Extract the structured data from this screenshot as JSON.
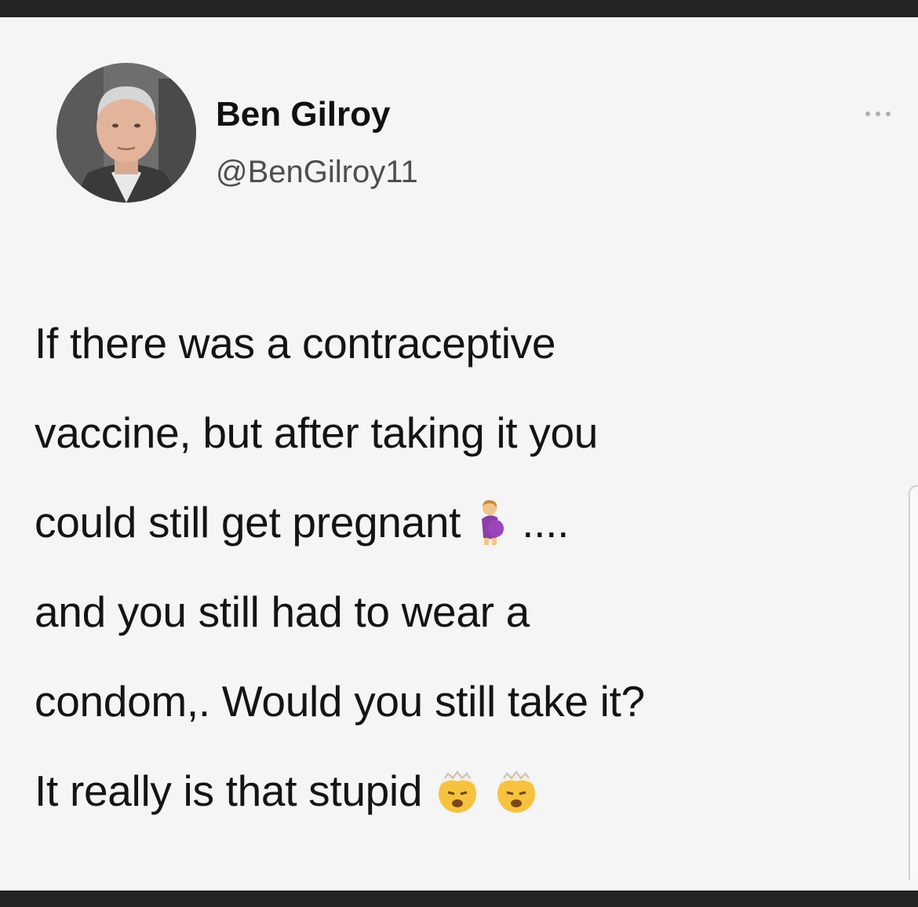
{
  "author": {
    "display_name": "Ben Gilroy",
    "handle": "@BenGilroy11"
  },
  "more_icon": "ellipsis-icon",
  "tweet": {
    "lines": [
      {
        "text": "If there was a contraceptive"
      },
      {
        "text": "vaccine, but after taking it you"
      },
      {
        "text": "could still get pregnant",
        "emoji": "pregnant-woman-emoji",
        "suffix": " ...."
      },
      {
        "text": "and you still had to wear a"
      },
      {
        "text": "condom,. Would you still take it?"
      },
      {
        "text": "It really is that stupid",
        "emoji": "exploding-head-emoji"
      }
    ]
  },
  "colors": {
    "background": "#f5f5f5",
    "frame": "#242424",
    "text": "#141414",
    "handle": "#4e4e4e"
  }
}
